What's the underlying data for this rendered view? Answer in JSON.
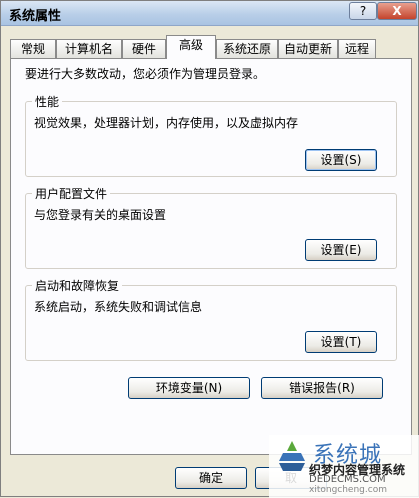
{
  "window": {
    "title": "系统属性",
    "help_label": "?",
    "close_label": "X"
  },
  "tabs": [
    {
      "label": "常规"
    },
    {
      "label": "计算机名"
    },
    {
      "label": "硬件"
    },
    {
      "label": "高级",
      "active": true
    },
    {
      "label": "系统还原"
    },
    {
      "label": "自动更新"
    },
    {
      "label": "远程"
    }
  ],
  "panel": {
    "notice": "要进行大多数改动，您必须作为管理员登录。",
    "performance": {
      "title": "性能",
      "description": "视觉效果，处理器计划，内存使用，以及虚拟内存",
      "button": "设置(S)"
    },
    "user_profiles": {
      "title": "用户配置文件",
      "description": "与您登录有关的桌面设置",
      "button": "设置(E)"
    },
    "startup_recovery": {
      "title": "启动和故障恢复",
      "description": "系统启动，系统失败和调试信息",
      "button": "设置(T)"
    },
    "env_button": "环境变量(N)",
    "error_button": "错误报告(R)"
  },
  "footer": {
    "ok_button": "确定",
    "cancel_button": "取"
  },
  "watermark": {
    "brand": "系统城",
    "line1": "织梦内容管理系统",
    "line2": "DEDECMS.COM",
    "line3": "xitongcheng.com"
  }
}
